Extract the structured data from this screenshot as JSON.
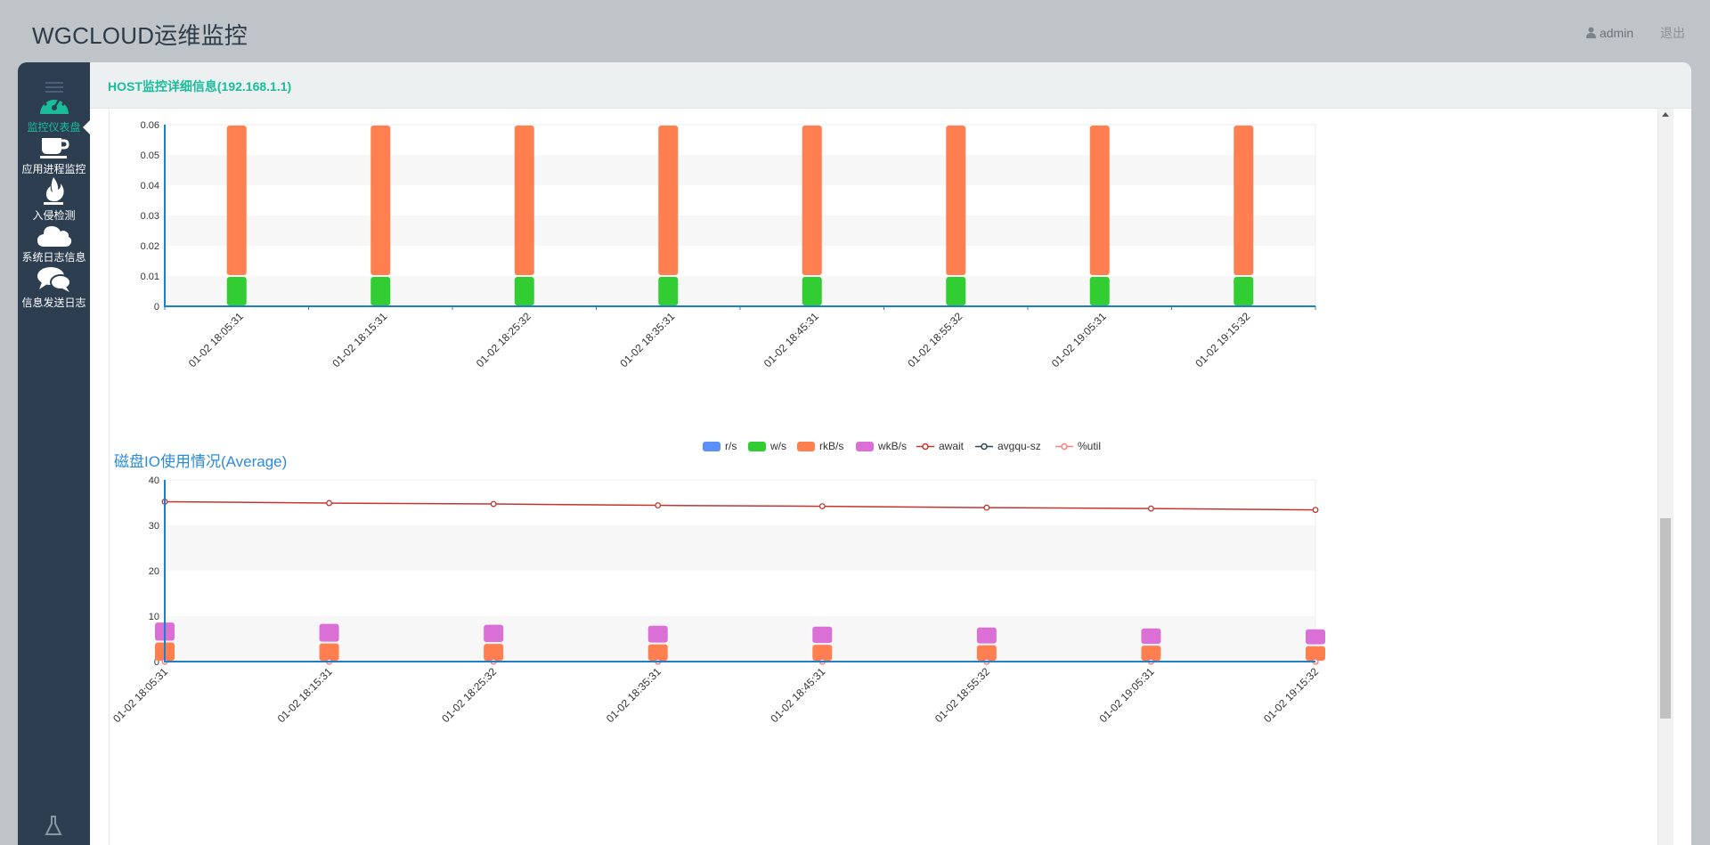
{
  "app": {
    "title": "WGCLOUD运维监控",
    "user": "admin",
    "logout": "退出"
  },
  "sidebar": {
    "items": [
      {
        "label": "监控仪表盘",
        "icon": "dashboard-icon",
        "active": true
      },
      {
        "label": "应用进程监控",
        "icon": "coffee-cup-icon",
        "active": false
      },
      {
        "label": "入侵检测",
        "icon": "fire-icon",
        "active": false
      },
      {
        "label": "系统日志信息",
        "icon": "cloud-icon",
        "active": false
      },
      {
        "label": "信息发送日志",
        "icon": "comments-icon",
        "active": false
      }
    ]
  },
  "header": {
    "title": "HOST监控详细信息(192.168.1.1)"
  },
  "colors": {
    "accent": "#1abc9c",
    "sidebar": "#2c3e50",
    "title_blue": "#2a8bd8",
    "r_s": "#5b8ff9",
    "w_s": "#32cd32",
    "rkB_s": "#ff7f50",
    "wkB_s": "#da70d6",
    "await": "#c23531",
    "avgqu_sz": "#2f4554",
    "util": "#ff7f7f"
  },
  "chart_data": [
    {
      "type": "bar",
      "title": "",
      "categories": [
        "01-02 18:05:31",
        "01-02 18:15:31",
        "01-02 18:25:32",
        "01-02 18:35:31",
        "01-02 18:45:31",
        "01-02 18:55:32",
        "01-02 19:05:31",
        "01-02 19:15:32"
      ],
      "series": [
        {
          "name": "",
          "stack": "io",
          "color": "#32cd32",
          "values": [
            0.01,
            0.01,
            0.01,
            0.01,
            0.01,
            0.01,
            0.01,
            0.01
          ]
        },
        {
          "name": "",
          "stack": "io",
          "color": "#ff7f50",
          "values": [
            0.05,
            0.05,
            0.05,
            0.05,
            0.05,
            0.05,
            0.05,
            0.05
          ]
        }
      ],
      "ylim": [
        0,
        0.06
      ],
      "yticks": [
        "0",
        "0.01",
        "0.02",
        "0.03",
        "0.04",
        "0.05",
        "0.06"
      ],
      "grid": true
    },
    {
      "type": "bar",
      "title": "磁盘IO使用情况(Average)",
      "legend": [
        "r/s",
        "w/s",
        "rkB/s",
        "wkB/s",
        "await",
        "avgqu-sz",
        "%util"
      ],
      "legend_position": "top-center",
      "categories": [
        "01-02 18:05:31",
        "01-02 18:15:31",
        "01-02 18:25:32",
        "01-02 18:35:31",
        "01-02 18:45:31",
        "01-02 18:55:32",
        "01-02 19:05:31",
        "01-02 19:15:32"
      ],
      "series": [
        {
          "name": "r/s",
          "kind": "bar",
          "stack": "io",
          "values": [
            0,
            0,
            0,
            0,
            0,
            0,
            0,
            0
          ]
        },
        {
          "name": "w/s",
          "kind": "bar",
          "stack": "io",
          "values": [
            0,
            0,
            0,
            0,
            0,
            0,
            0,
            0
          ]
        },
        {
          "name": "rkB/s",
          "kind": "bar",
          "stack": "io",
          "values": [
            4.4,
            4.2,
            4.1,
            4.0,
            3.9,
            3.8,
            3.7,
            3.6
          ]
        },
        {
          "name": "wkB/s",
          "kind": "bar",
          "stack": "io",
          "values": [
            4.4,
            4.3,
            4.2,
            4.1,
            4.0,
            3.9,
            3.8,
            3.7
          ]
        },
        {
          "name": "await",
          "kind": "line",
          "values": [
            35.2,
            34.9,
            34.7,
            34.4,
            34.2,
            33.9,
            33.7,
            33.4
          ]
        },
        {
          "name": "avgqu-sz",
          "kind": "line",
          "values": [
            0,
            0,
            0,
            0,
            0,
            0,
            0,
            0
          ]
        },
        {
          "name": "%util",
          "kind": "line",
          "values": [
            0,
            0,
            0,
            0,
            0,
            0,
            0,
            0
          ]
        }
      ],
      "ylim": [
        0,
        40
      ],
      "yticks": [
        "0",
        "10",
        "20",
        "30",
        "40"
      ],
      "grid": true
    }
  ]
}
